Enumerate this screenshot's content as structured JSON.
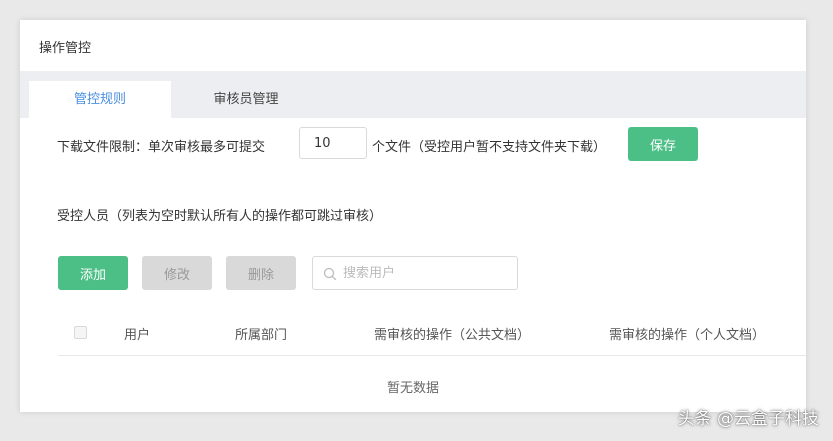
{
  "panel": {
    "title": "操作管控"
  },
  "tabs": [
    {
      "label": "管控规则",
      "active": true
    },
    {
      "label": "审核员管理",
      "active": false
    }
  ],
  "download_limit": {
    "label": "下载文件限制：单次审核最多可提交",
    "value": "10",
    "suffix": "个文件（受控用户暂不支持文件夹下载）",
    "save_label": "保存"
  },
  "controlled_users": {
    "label": "受控人员（列表为空时默认所有人的操作都可跳过审核）"
  },
  "toolbar": {
    "add_label": "添加",
    "edit_label": "修改",
    "delete_label": "删除",
    "search_placeholder": "搜索用户"
  },
  "table": {
    "columns": [
      "用户",
      "所属部门",
      "需审核的操作（公共文档）",
      "需审核的操作（个人文档）"
    ],
    "empty_text": "暂无数据"
  },
  "watermark": "头条 @云盒子科技",
  "colors": {
    "accent_green": "#4cbf87",
    "tab_active_text": "#4a8fe0",
    "disabled_bg": "#d9d9d9"
  }
}
